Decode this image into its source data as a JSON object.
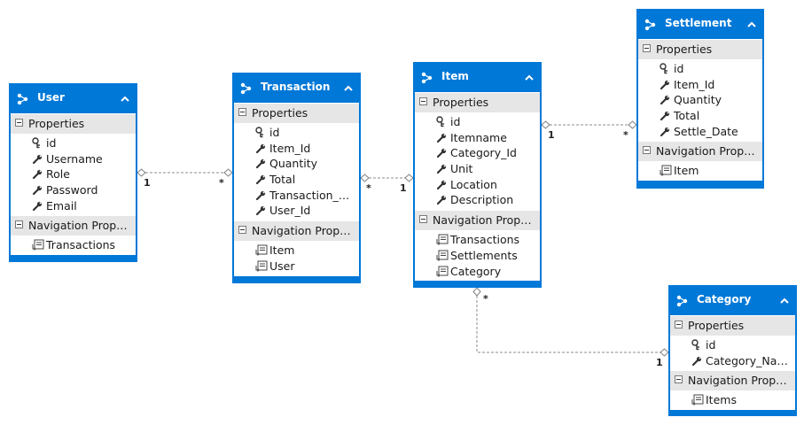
{
  "sections": {
    "properties": "Properties",
    "navigation": "Navigation Proper..."
  },
  "colors": {
    "header": "#0078d7",
    "section": "#e6e6e6",
    "connector": "#7f7f7f"
  },
  "icons": {
    "entity": "entity-icon",
    "key": "key-icon",
    "property": "wrench-icon",
    "navigation": "navigation-property-icon",
    "collapse": "chevron-up-icon"
  },
  "entities": {
    "user": {
      "title": "User",
      "properties": [
        {
          "name": "id",
          "key": true
        },
        {
          "name": "Username"
        },
        {
          "name": "Role"
        },
        {
          "name": "Password"
        },
        {
          "name": "Email"
        }
      ],
      "navigation": [
        "Transactions"
      ]
    },
    "transaction": {
      "title": "Transaction",
      "properties": [
        {
          "name": "id",
          "key": true
        },
        {
          "name": "Item_Id"
        },
        {
          "name": "Quantity"
        },
        {
          "name": "Total"
        },
        {
          "name": "Transaction_Da..."
        },
        {
          "name": "User_Id"
        }
      ],
      "navigation": [
        "Item",
        "User"
      ]
    },
    "item": {
      "title": "Item",
      "properties": [
        {
          "name": "id",
          "key": true
        },
        {
          "name": "Itemname"
        },
        {
          "name": "Category_Id"
        },
        {
          "name": "Unit"
        },
        {
          "name": "Location"
        },
        {
          "name": "Description"
        }
      ],
      "navigation": [
        "Transactions",
        "Settlements",
        "Category"
      ]
    },
    "settlement": {
      "title": "Settlement",
      "properties": [
        {
          "name": "id",
          "key": true
        },
        {
          "name": "Item_Id"
        },
        {
          "name": "Quantity"
        },
        {
          "name": "Total"
        },
        {
          "name": "Settle_Date"
        }
      ],
      "navigation": [
        "Item"
      ]
    },
    "category": {
      "title": "Category",
      "properties": [
        {
          "name": "id",
          "key": true
        },
        {
          "name": "Category_Name"
        }
      ],
      "navigation": [
        "Items"
      ]
    }
  },
  "associations": [
    {
      "from": "User",
      "to": "Transaction",
      "from_mult": "1",
      "to_mult": "*"
    },
    {
      "from": "Transaction",
      "to": "Item",
      "from_mult": "*",
      "to_mult": "1"
    },
    {
      "from": "Item",
      "to": "Settlement",
      "from_mult": "1",
      "to_mult": "*"
    },
    {
      "from": "Item",
      "to": "Category",
      "from_mult": "*",
      "to_mult": "1"
    }
  ]
}
